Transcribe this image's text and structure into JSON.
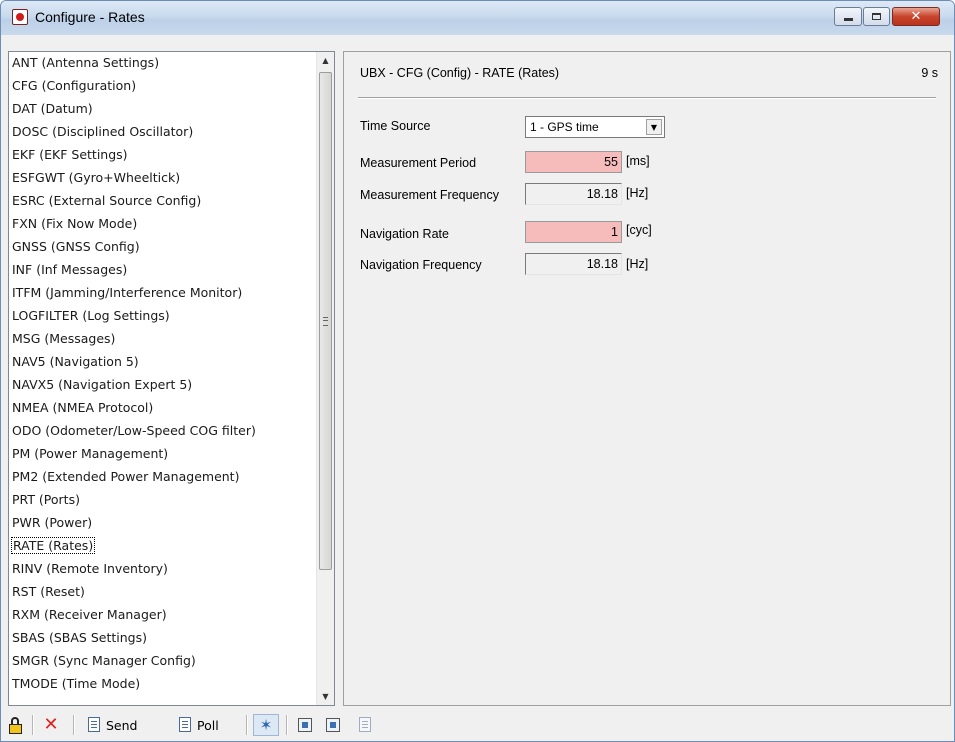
{
  "window": {
    "title": "Configure - Rates",
    "buttons": {
      "minimize": "minimize",
      "maximize": "maximize",
      "close": "✕"
    }
  },
  "list": {
    "items": [
      "ANT (Antenna Settings)",
      "CFG (Configuration)",
      "DAT (Datum)",
      "DOSC (Disciplined Oscillator)",
      "EKF (EKF Settings)",
      "ESFGWT (Gyro+Wheeltick)",
      "ESRC (External Source Config)",
      "FXN (Fix Now Mode)",
      "GNSS (GNSS Config)",
      "INF (Inf Messages)",
      "ITFM (Jamming/Interference Monitor)",
      "LOGFILTER (Log Settings)",
      "MSG (Messages)",
      "NAV5 (Navigation 5)",
      "NAVX5 (Navigation Expert 5)",
      "NMEA (NMEA Protocol)",
      "ODO (Odometer/Low-Speed COG filter)",
      "PM (Power Management)",
      "PM2 (Extended Power Management)",
      "PRT (Ports)",
      "PWR (Power)",
      "RATE (Rates)",
      "RINV (Remote Inventory)",
      "RST (Reset)",
      "RXM (Receiver Manager)",
      "SBAS (SBAS Settings)",
      "SMGR (Sync Manager Config)",
      "TMODE (Time Mode)"
    ],
    "selected": "RATE (Rates)"
  },
  "panel": {
    "header": "UBX - CFG (Config) - RATE (Rates)",
    "timer": "9 s",
    "time_source": {
      "label": "Time Source",
      "value": "1 - GPS time"
    },
    "measurement_period": {
      "label": "Measurement Period",
      "value": "55",
      "unit": "[ms]"
    },
    "measurement_frequency": {
      "label": "Measurement Frequency",
      "value": "18.18",
      "unit": "[Hz]"
    },
    "navigation_rate": {
      "label": "Navigation Rate",
      "value": "1",
      "unit": "[cyc]"
    },
    "navigation_frequency": {
      "label": "Navigation Frequency",
      "value": "18.18",
      "unit": "[Hz]"
    }
  },
  "toolbar": {
    "send_label": "Send",
    "poll_label": "Poll"
  },
  "colors": {
    "editable_field": "#f6bcbc",
    "titlebar": "#c9daee",
    "close_button": "#c9442d"
  }
}
